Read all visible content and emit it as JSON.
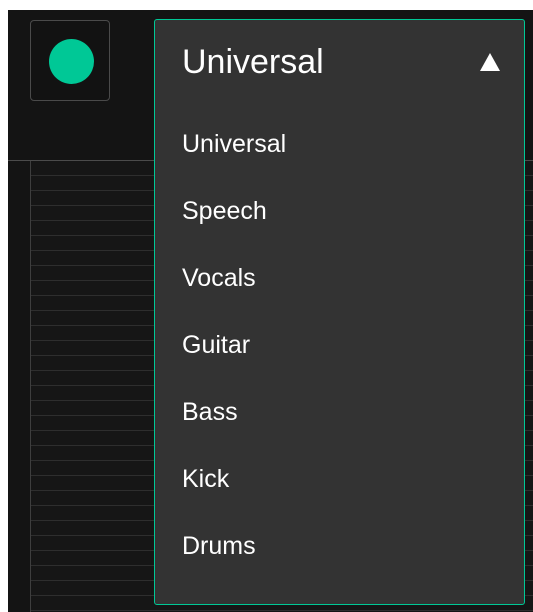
{
  "colors": {
    "accent": "#00c896",
    "panel_background": "#151515",
    "dropdown_background": "#333333",
    "text": "#ffffff"
  },
  "power_button": {
    "icon": "power-led-icon",
    "state": "on"
  },
  "analyzer": {
    "grid": true
  },
  "dropdown": {
    "selected": "Universal",
    "expanded": true,
    "caret_icon": "caret-up-icon",
    "options": [
      "Universal",
      "Speech",
      "Vocals",
      "Guitar",
      "Bass",
      "Kick",
      "Drums"
    ]
  }
}
